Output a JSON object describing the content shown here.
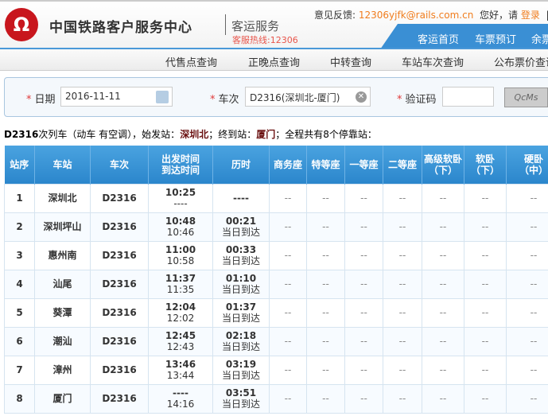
{
  "header": {
    "logo": "Ω",
    "brand": "中国铁路客户服务中心",
    "subtitle": "客运服务",
    "hotline": "客服热线:12306",
    "feedback_label": "意见反馈:",
    "feedback_email": "12306yjfk@rails.com.cn",
    "greeting": "您好，请",
    "login": "登录",
    "sep": "|"
  },
  "top_nav": [
    "客运首页",
    "车票预订",
    "余票"
  ],
  "sub_nav": [
    "代售点查询",
    "正晚点查询",
    "中转查询",
    "车站车次查询",
    "公布票价查询"
  ],
  "form": {
    "date_label": "日期",
    "date_value": "2016-11-11",
    "train_label": "车次",
    "train_value": "D2316(深圳北-厦门)",
    "captcha_label": "验证码",
    "captcha_value": "",
    "captcha_image_text": "QcMs"
  },
  "summary": {
    "train": "D2316",
    "text1": "次列车（动车 有空调），始发站：",
    "origin": "深圳北",
    "text2": "；终到站：",
    "dest": "厦门",
    "text3": "；全程共有8个停靠站："
  },
  "table": {
    "headers": [
      "站序",
      "车站",
      "车次",
      "出发时间\n到达时间",
      "历时",
      "商务座",
      "特等座",
      "一等座",
      "二等座",
      "高级软卧\n（下）",
      "软卧\n（下）",
      "硬卧\n（中）"
    ],
    "rows": [
      [
        "1",
        "深圳北",
        "D2316",
        "10:25",
        "----",
        "----",
        ""
      ],
      [
        "2",
        "深圳坪山",
        "D2316",
        "10:48",
        "10:46",
        "00:21",
        "当日到达"
      ],
      [
        "3",
        "惠州南",
        "D2316",
        "11:00",
        "10:58",
        "00:33",
        "当日到达"
      ],
      [
        "4",
        "汕尾",
        "D2316",
        "11:37",
        "11:35",
        "01:10",
        "当日到达"
      ],
      [
        "5",
        "葵潭",
        "D2316",
        "12:04",
        "12:02",
        "01:37",
        "当日到达"
      ],
      [
        "6",
        "潮汕",
        "D2316",
        "12:45",
        "12:43",
        "02:18",
        "当日到达"
      ],
      [
        "7",
        "漳州",
        "D2316",
        "13:46",
        "13:44",
        "03:19",
        "当日到达"
      ],
      [
        "8",
        "厦门",
        "D2316",
        "----",
        "14:16",
        "03:51",
        "当日到达"
      ]
    ],
    "empty_cell": "--"
  }
}
